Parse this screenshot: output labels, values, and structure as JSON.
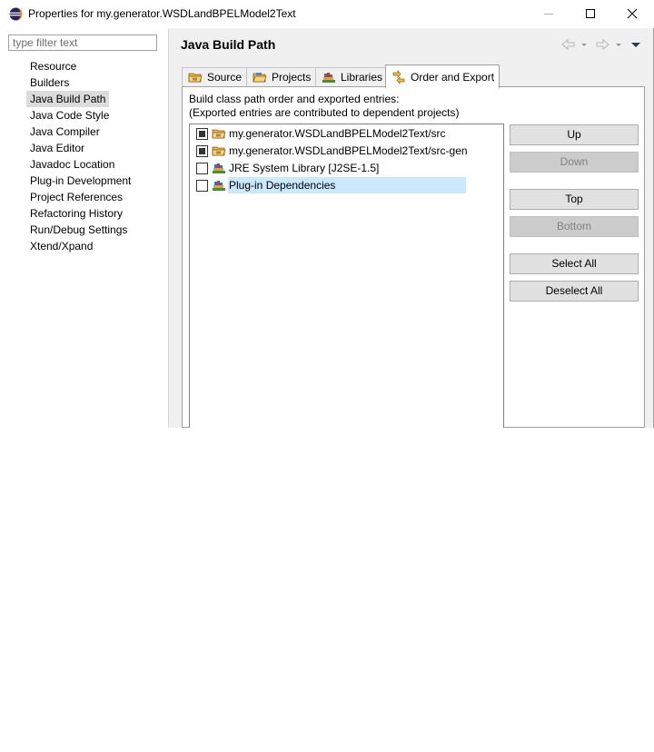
{
  "window": {
    "title": "Properties for my.generator.WSDLandBPELModel2Text"
  },
  "filter": {
    "placeholder": "type filter text",
    "value": ""
  },
  "nav": {
    "items": [
      {
        "label": "Resource",
        "selected": false
      },
      {
        "label": "Builders",
        "selected": false
      },
      {
        "label": "Java Build Path",
        "selected": true
      },
      {
        "label": "Java Code Style",
        "selected": false
      },
      {
        "label": "Java Compiler",
        "selected": false
      },
      {
        "label": "Java Editor",
        "selected": false
      },
      {
        "label": "Javadoc Location",
        "selected": false
      },
      {
        "label": "Plug-in Development",
        "selected": false
      },
      {
        "label": "Project References",
        "selected": false
      },
      {
        "label": "Refactoring History",
        "selected": false
      },
      {
        "label": "Run/Debug Settings",
        "selected": false
      },
      {
        "label": "Xtend/Xpand",
        "selected": false
      }
    ]
  },
  "page": {
    "title": "Java Build Path"
  },
  "tabs": [
    {
      "label": "Source",
      "icon": "source-folder-icon",
      "active": false
    },
    {
      "label": "Projects",
      "icon": "projects-folder-icon",
      "active": false
    },
    {
      "label": "Libraries",
      "icon": "libraries-icon",
      "active": false
    },
    {
      "label": "Order and Export",
      "icon": "order-export-icon",
      "active": true
    }
  ],
  "order_export": {
    "description_line1": "Build class path order and exported entries:",
    "description_line2": "(Exported entries are contributed to dependent projects)",
    "entries": [
      {
        "label": "my.generator.WSDLandBPELModel2Text/src",
        "checked": true,
        "icon": "source-folder-icon",
        "selected": false
      },
      {
        "label": "my.generator.WSDLandBPELModel2Text/src-gen",
        "checked": true,
        "icon": "source-folder-icon",
        "selected": false
      },
      {
        "label": "JRE System Library [J2SE-1.5]",
        "checked": false,
        "icon": "library-icon",
        "selected": false
      },
      {
        "label": "Plug-in Dependencies",
        "checked": false,
        "icon": "library-icon",
        "selected": true
      }
    ],
    "buttons": {
      "up": "Up",
      "down": "Down",
      "top": "Top",
      "bottom": "Bottom",
      "select_all": "Select All",
      "deselect_all": "Deselect All"
    }
  }
}
